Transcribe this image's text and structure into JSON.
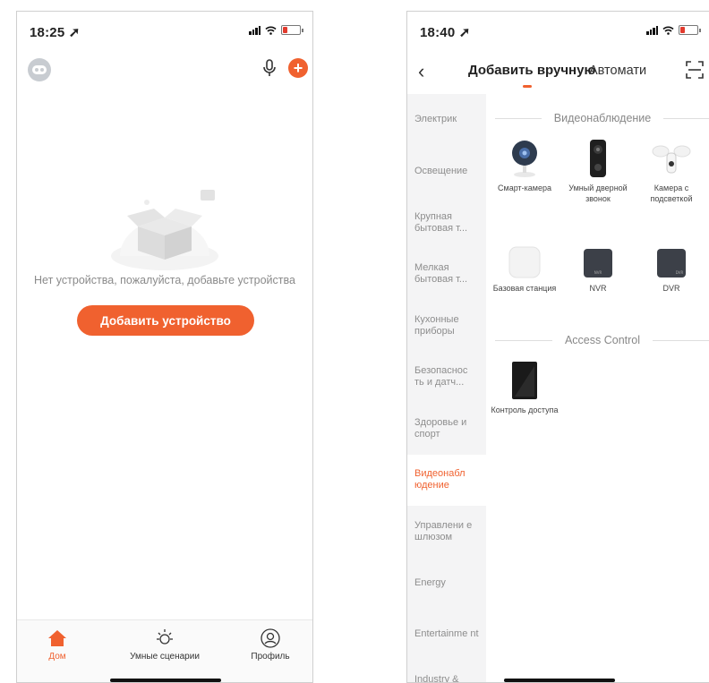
{
  "left_screen": {
    "status": {
      "time": "18:25"
    },
    "empty_message": "Нет устройства, пожалуйста, добавьте устройства",
    "add_button": "Добавить устройство",
    "tabs": [
      {
        "label": "Дом",
        "icon": "home-icon"
      },
      {
        "label": "Умные сценарии",
        "icon": "sun-icon"
      },
      {
        "label": "Профиль",
        "icon": "profile-icon"
      }
    ],
    "accent_color": "#f0612f"
  },
  "right_screen": {
    "status": {
      "time": "18:40"
    },
    "nav": {
      "active_tab": "Добавить вручную",
      "other_tab": "Автомати"
    },
    "categories": [
      "Электрик",
      "Освещение",
      "Крупная бытовая т...",
      "Мелкая бытовая т...",
      "Кухонные приборы",
      "Безопаснос ть и датч...",
      "Здоровье и спорт",
      "Видеонабл юдение",
      "Управлени е шлюзом",
      "Energy",
      "Entertainme nt",
      "Industry & Agriculture"
    ],
    "active_category_index": 7,
    "sections": [
      {
        "title": "Видеонаблюдение",
        "devices": [
          {
            "label": "Смарт-камера",
            "icon": "smart-camera-icon"
          },
          {
            "label": "Умный дверной звонок",
            "icon": "doorbell-icon"
          },
          {
            "label": "Камера с подсветкой",
            "icon": "floodlight-camera-icon"
          },
          {
            "label": "Базовая станция",
            "icon": "base-station-icon"
          },
          {
            "label": "NVR",
            "icon": "nvr-icon",
            "badge": "NVR"
          },
          {
            "label": "DVR",
            "icon": "dvr-icon",
            "badge": "DVR"
          }
        ]
      },
      {
        "title": "Access Control",
        "devices": [
          {
            "label": "Контроль доступа",
            "icon": "access-control-icon"
          }
        ]
      }
    ]
  }
}
